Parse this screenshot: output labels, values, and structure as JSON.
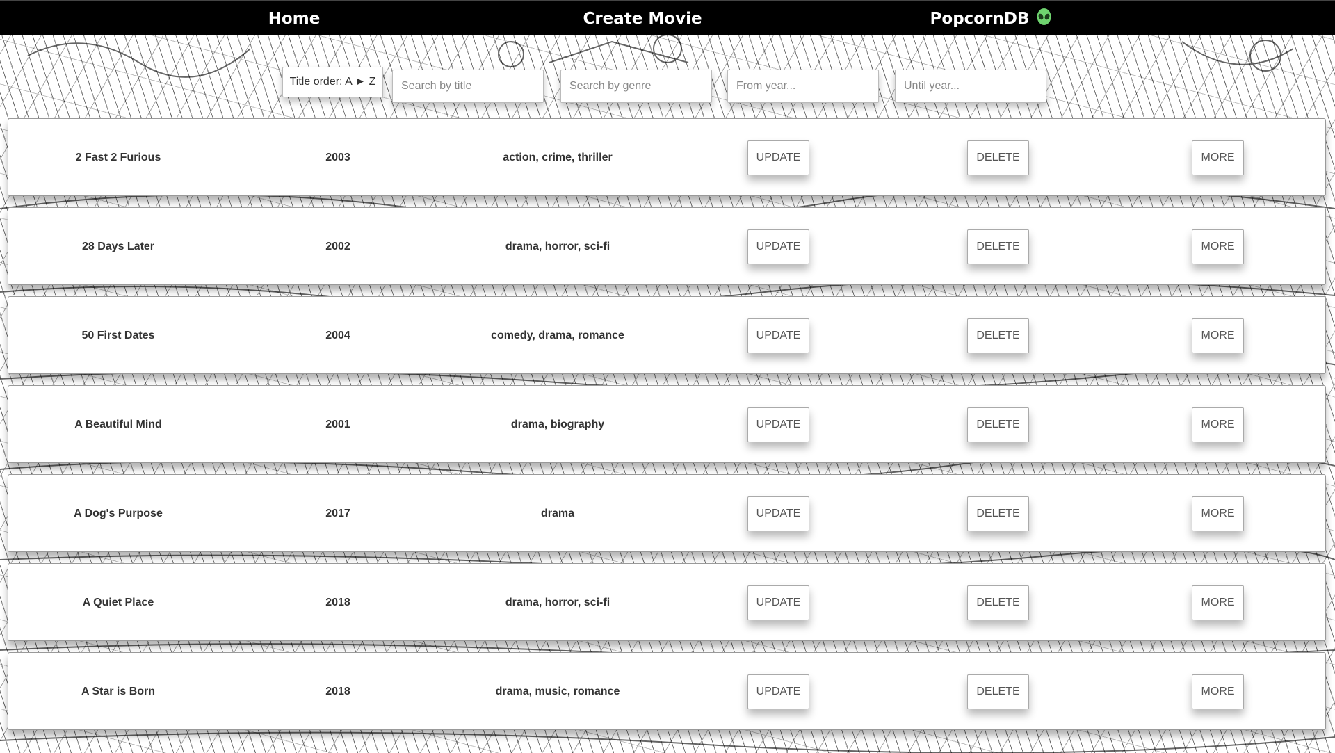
{
  "nav": {
    "home": "Home",
    "create": "Create Movie",
    "brand": "PopcornDB",
    "brand_icon": "alien-icon"
  },
  "filters": {
    "order_label": "Title order: A ► Z",
    "title_placeholder": "Search by title",
    "genre_placeholder": "Search by genre",
    "from_placeholder": "From year...",
    "until_placeholder": "Until year..."
  },
  "row_buttons": {
    "update": "UPDATE",
    "delete": "DELETE",
    "more": "MORE"
  },
  "movies": [
    {
      "title": "2 Fast 2 Furious",
      "year": "2003",
      "genres": "action, crime, thriller"
    },
    {
      "title": "28 Days Later",
      "year": "2002",
      "genres": "drama, horror, sci-fi"
    },
    {
      "title": "50 First Dates",
      "year": "2004",
      "genres": "comedy, drama, romance"
    },
    {
      "title": "A Beautiful Mind",
      "year": "2001",
      "genres": "drama, biography"
    },
    {
      "title": "A Dog's Purpose",
      "year": "2017",
      "genres": "drama"
    },
    {
      "title": "A Quiet Place",
      "year": "2018",
      "genres": "drama, horror, sci-fi"
    },
    {
      "title": "A Star is Born",
      "year": "2018",
      "genres": "drama, music, romance"
    }
  ],
  "colors": {
    "navbar": "#000000",
    "nav_text": "#ffffff",
    "alien": "#6fd36f"
  }
}
